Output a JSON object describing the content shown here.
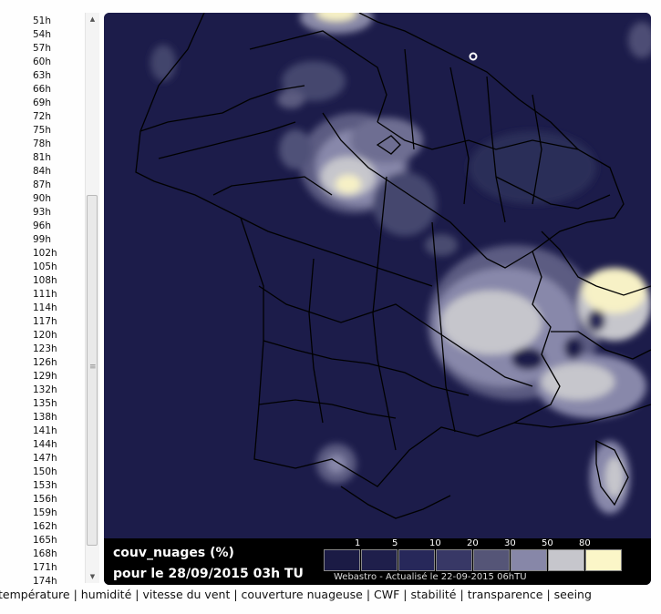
{
  "hours": [
    "51h",
    "54h",
    "57h",
    "60h",
    "63h",
    "66h",
    "69h",
    "72h",
    "75h",
    "78h",
    "81h",
    "84h",
    "87h",
    "90h",
    "93h",
    "96h",
    "99h",
    "102h",
    "105h",
    "108h",
    "111h",
    "114h",
    "117h",
    "120h",
    "123h",
    "126h",
    "129h",
    "132h",
    "135h",
    "138h",
    "141h",
    "144h",
    "147h",
    "150h",
    "153h",
    "156h",
    "159h",
    "162h",
    "165h",
    "168h",
    "171h",
    "174h"
  ],
  "map": {
    "title": "couv_nuages (%)",
    "date": "pour le 28/09/2015 03h TU",
    "credit": "Webastro - Actualisé le 22-09-2015 06hTU",
    "legend": {
      "labels": [
        "1",
        "5",
        "10",
        "20",
        "30",
        "50",
        "80"
      ],
      "colors": [
        "#1b1b45",
        "#1f1f4b",
        "#27285a",
        "#383866",
        "#555577",
        "#8787a8",
        "#c6c6cc",
        "#fbf6c8"
      ]
    }
  },
  "nav": {
    "items": [
      "température",
      "humidité",
      "vitesse du vent",
      "couverture nuageuse",
      "CWF",
      "stabilité",
      "transparence",
      "seeing"
    ],
    "separator": "|"
  }
}
